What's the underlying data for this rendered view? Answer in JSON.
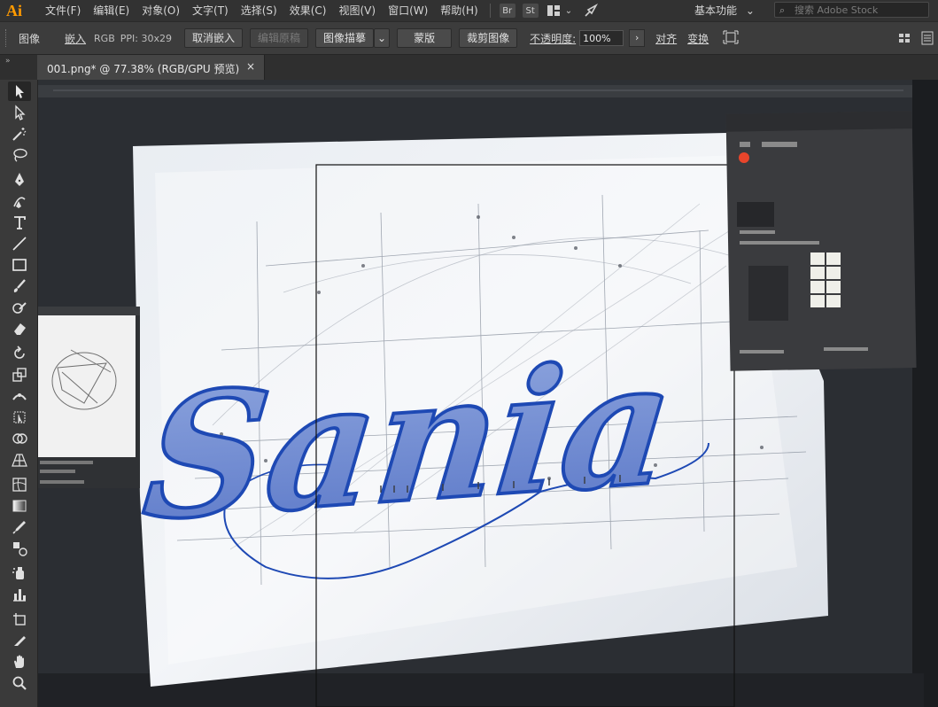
{
  "app": {
    "logo": "Ai"
  },
  "menu": [
    "文件(F)",
    "编辑(E)",
    "对象(O)",
    "文字(T)",
    "选择(S)",
    "效果(C)",
    "视图(V)",
    "窗口(W)",
    "帮助(H)"
  ],
  "menubar_icons": {
    "bridge": "Br",
    "stock": "St"
  },
  "workspace": {
    "label": "基本功能",
    "chevron": "⌄"
  },
  "search": {
    "placeholder": "搜索 Adobe Stock"
  },
  "control_bar": {
    "object_label": "图像",
    "embed_link": "嵌入",
    "color_mode": "RGB",
    "ppi": "PPI: 30x29",
    "unembed_button": "取消嵌入",
    "edit_original_button": "编辑原稿",
    "image_trace_button": "图像描摹",
    "mask_button": "蒙版",
    "crop_button": "裁剪图像",
    "opacity_label": "不透明度:",
    "opacity_value": "100%",
    "align_button": "对齐",
    "transform_button": "变换"
  },
  "document_tab": {
    "title": "001.png* @ 77.38% (RGB/GPU 预览)",
    "close": "×"
  },
  "artwork": {
    "lettering": "Sania",
    "lettering_color": "#1e49b4"
  },
  "colors": {
    "accent": "#ff9a00",
    "panel_bg": "#3c3c3c",
    "canvas_bg": "#262626"
  }
}
